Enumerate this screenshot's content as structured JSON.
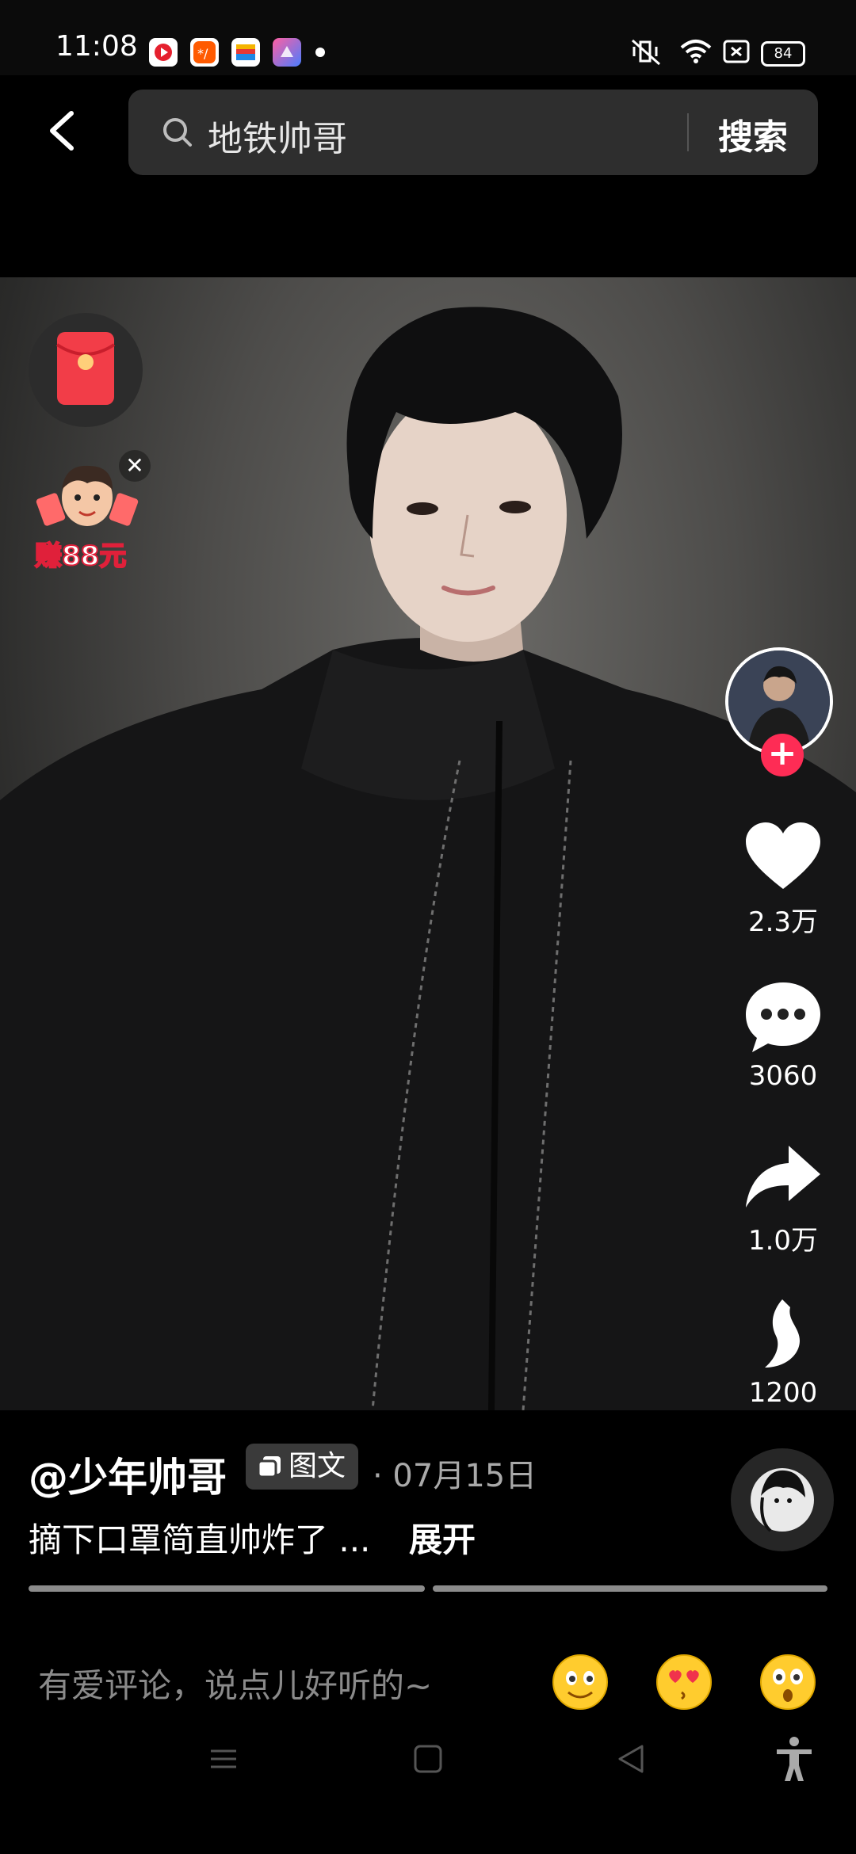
{
  "status_bar": {
    "time": "11:08",
    "battery": "84",
    "apps": [
      "video-app-icon",
      "taobao-icon",
      "wallet-icon",
      "shortcut-icon"
    ]
  },
  "search": {
    "query": "地铁帅哥",
    "button_label": "搜索"
  },
  "widgets": {
    "earn_label": "赚88元",
    "close_glyph": "✕"
  },
  "actions": {
    "follow_glyph": "+",
    "likes": "2.3万",
    "comments": "3060",
    "shares": "1.0万",
    "favorites": "1200"
  },
  "post": {
    "author": "@少年帅哥",
    "type_label": "图文",
    "date": "· 07月15日",
    "caption": "摘下口罩简直帅炸了 ...",
    "expand_label": "展开",
    "pages_total": 2,
    "current_page": 1
  },
  "comment_bar": {
    "placeholder": "有爱评论，说点儿好听的~",
    "emojis": [
      "smiling-emoji",
      "heart-eyes-kiss-emoji",
      "surprised-emoji"
    ]
  },
  "colors": {
    "accent": "#fe2c55",
    "search_bg": "#2e2e2e"
  }
}
